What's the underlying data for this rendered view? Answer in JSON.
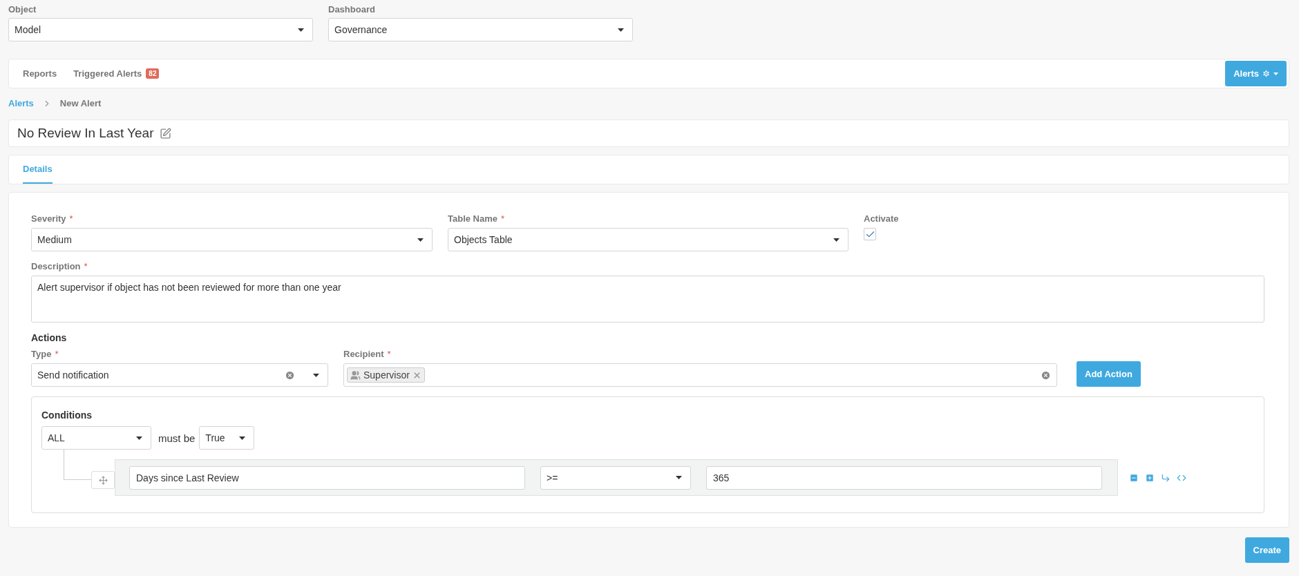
{
  "filters": [
    {
      "label": "Object",
      "value": "Model"
    },
    {
      "label": "Dashboard",
      "value": "Governance"
    }
  ],
  "nav": {
    "tabs": [
      {
        "label": "Reports",
        "selected": false
      },
      {
        "label": "Triggered Alerts",
        "badge": "82",
        "selected": false
      }
    ],
    "menu_button": "Alerts"
  },
  "breadcrumb": [
    {
      "label": "Alerts",
      "kind": "link"
    },
    {
      "label": "New Alert",
      "kind": "current"
    }
  ],
  "alert_title": "No Review In Last Year",
  "detail_tabs": [
    {
      "label": "Details",
      "selected": true
    }
  ],
  "form": {
    "severity": {
      "label": "Severity",
      "required_mark": "*",
      "value": "Medium"
    },
    "table_name": {
      "label": "Table Name",
      "required_mark": "*",
      "value": "Objects Table"
    },
    "activate": {
      "label": "Activate",
      "checked": true
    },
    "description": {
      "label": "Description",
      "required_mark": "*",
      "value": "Alert supervisor if object has not been reviewed for more than one year"
    },
    "actions": {
      "title": "Actions",
      "type": {
        "label": "Type",
        "required_mark": "*",
        "value": "Send notification"
      },
      "recipient": {
        "label": "Recipient",
        "required_mark": "*",
        "tags": [
          "Supervisor"
        ]
      },
      "add_button": "Add Action"
    },
    "conditions": {
      "title": "Conditions",
      "combinator": "ALL",
      "connector": "must be",
      "result": "True",
      "rules": [
        {
          "field": "Days since Last Review",
          "operator": ">=",
          "value": "365"
        }
      ]
    }
  },
  "create_button": "Create"
}
